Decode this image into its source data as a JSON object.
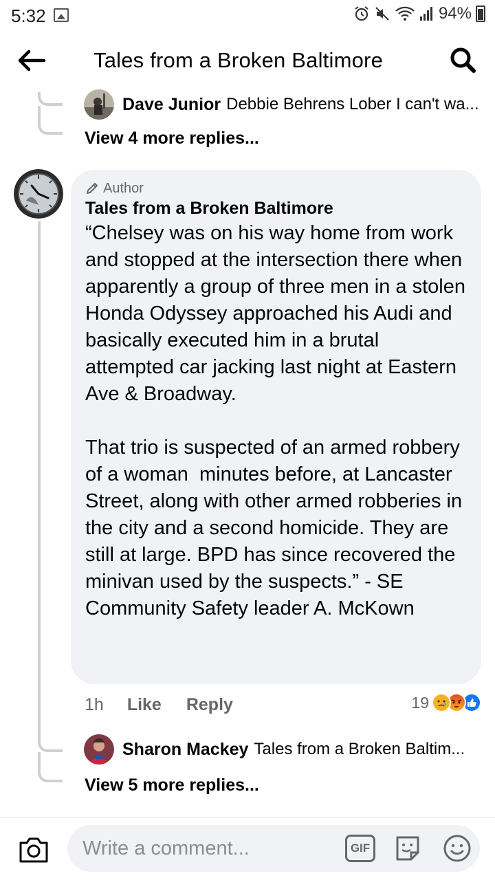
{
  "status_bar": {
    "time": "5:32",
    "battery": "94%"
  },
  "header": {
    "title": "Tales from a Broken Baltimore",
    "back_icon": "arrow-left-icon",
    "search_icon": "search-icon"
  },
  "top_reply": {
    "name": "Dave Junior",
    "text": "Debbie Behrens Lober I can't wa..."
  },
  "top_view_more": "View 4 more replies...",
  "comment": {
    "badge": "Author",
    "author": "Tales from a Broken Baltimore",
    "body": "“Chelsey was on his way home from work and stopped at the intersection there when apparently a group of three men in a stolen Honda Odyssey approached his Audi and basically executed him in a brutal attempted car jacking last night at Eastern Ave & Broadway.\n\nThat trio is suspected of an armed robbery of a woman  minutes before, at Lancaster Street, along with other armed robberies in the city and a second homicide. They are still at large. BPD has since recovered the minivan used by the suspects.” - SE Community Safety leader A. McKown",
    "time": "1h",
    "like_label": "Like",
    "reply_label": "Reply",
    "reaction_count": "19",
    "reaction_icons": [
      "sad-reaction-icon",
      "angry-reaction-icon",
      "like-reaction-icon"
    ]
  },
  "bottom_reply": {
    "name": "Sharon Mackey",
    "text": "Tales from a Broken Baltim..."
  },
  "bottom_view_more": "View 5 more replies...",
  "composer": {
    "placeholder": "Write a comment...",
    "gif_label": "GIF"
  },
  "colors": {
    "bubble": "#f0f2f5",
    "secondary_text": "#65676b",
    "thread_line": "#ced0d4",
    "like_blue": "#1877f2",
    "angry_orange": "#f0613a",
    "sad_yellow": "#f7b125"
  }
}
